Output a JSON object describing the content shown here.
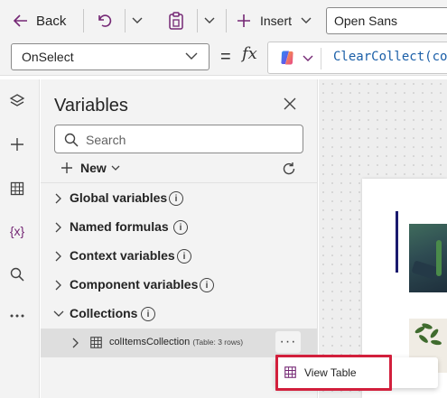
{
  "toolbar": {
    "back_label": "Back",
    "insert_label": "Insert",
    "font_value": "Open Sans"
  },
  "formula_bar": {
    "property_value": "OnSelect",
    "equals": "=",
    "fx": "fx",
    "formula_text": "ClearCollect(co"
  },
  "panel": {
    "title": "Variables",
    "search_placeholder": "Search",
    "new_label": "New",
    "tree": [
      {
        "label": "Global variables",
        "expanded": false
      },
      {
        "label": "Named formulas",
        "expanded": false
      },
      {
        "label": "Context variables",
        "expanded": false
      },
      {
        "label": "Component variables",
        "expanded": false
      },
      {
        "label": "Collections",
        "expanded": true
      }
    ],
    "collection_item": {
      "name": "colItemsCollection",
      "meta": "(Table: 3 rows)",
      "more_label": "···"
    }
  },
  "rail": {
    "items": [
      "layers-icon",
      "plus-icon",
      "table-icon",
      "variables-icon",
      "search-icon",
      "more-icon"
    ],
    "variables_label": "{x}"
  },
  "context_menu": {
    "items": [
      {
        "label": "View Table",
        "icon": "table-icon"
      }
    ]
  },
  "colors": {
    "accent_purple": "#742774",
    "formula_blue": "#1b5fa8",
    "highlight_red": "#d21f3c",
    "panel_bg": "#f3f3f3"
  }
}
